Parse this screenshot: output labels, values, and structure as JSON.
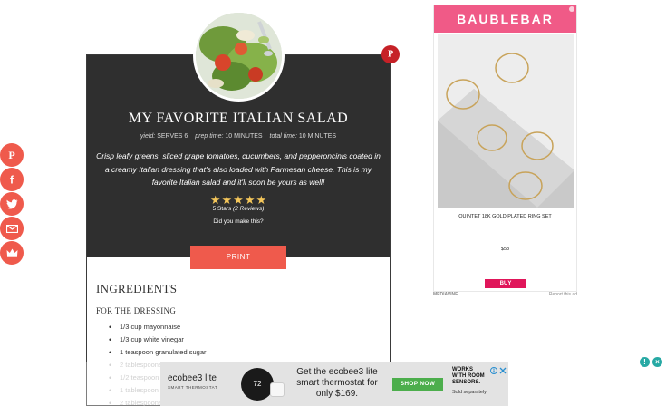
{
  "recipe": {
    "title": "MY FAVORITE ITALIAN SALAD",
    "yield_label": "yield:",
    "yield_value": "SERVES 6",
    "prep_label": "prep time:",
    "prep_value": "10 MINUTES",
    "total_label": "total time:",
    "total_value": "10 MINUTES",
    "description": "Crisp leafy greens, sliced grape tomatoes, cucumbers, and pepperoncinis coated in a creamy Italian dressing that's also loaded with Parmesan cheese. This is my favorite Italian salad and it'll soon be yours as well!",
    "rating_stars": 5,
    "rating_text": "5 Stars",
    "rating_reviews": "(2 Reviews)",
    "made_it": "Did you make this?",
    "print_label": "PRINT",
    "ingredients_heading": "INGREDIENTS",
    "dressing_heading": "FOR THE DRESSING",
    "ingredients": [
      "1/3 cup mayonnaise",
      "1/3 cup white vinegar",
      "1 teaspoon granulated sugar",
      "2 tablespoons",
      "1/2 teaspoon",
      "1 tablespoon",
      "2 tablespoons"
    ]
  },
  "social": {
    "icons": [
      "pinterest-icon",
      "facebook-icon",
      "twitter-icon",
      "email-icon",
      "crown-icon"
    ]
  },
  "ad": {
    "brand": "BAUBLEBAR",
    "product": "QUINTET 18K GOLD PLATED RING SET",
    "price": "$58",
    "buy": "BUY",
    "network": "MEDIAVINE",
    "report": "Report this ad",
    "brand_color": "#f05a87",
    "buy_color": "#e0165a"
  },
  "banner": {
    "brand": "ecobee3 lite",
    "brand_sub": "SMART THERMOSTAT",
    "device_reading": "72",
    "headline_1": "Get the ecobee3 lite",
    "headline_2": "smart thermostat for",
    "headline_3": "only $169.",
    "cta": "SHOP NOW",
    "right_1": "WORKS",
    "right_2": "WITH ROOM",
    "right_3": "SENSORS.",
    "right_sold": "Sold separately."
  },
  "colors": {
    "accent": "#ef5a4c",
    "card_dark": "#2f2f2f",
    "star": "#f4c65a",
    "pinterest": "#c62127"
  }
}
